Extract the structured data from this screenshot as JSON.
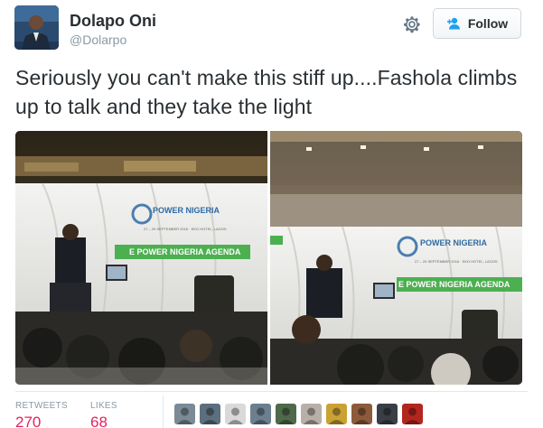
{
  "author": {
    "name": "Dolapo Oni",
    "handle": "@Dolarpo"
  },
  "actions": {
    "gear_icon": "gear-icon",
    "follow_label": "Follow",
    "follow_icon": "add-person-icon"
  },
  "tweet": {
    "text": "Seriously you can't make this stiff up....Fashola climbs up to talk and they take the light"
  },
  "photos": [
    {
      "banner_title": "POWER NIGERIA",
      "banner_date": "27 – 29 SEPTEMBER 2016 · EKO HOTEL, LAGOS",
      "banner_agenda": "E POWER NIGERIA AGENDA"
    },
    {
      "banner_title": "POWER NIGERIA",
      "banner_date": "27 – 29 SEPTEMBER 2016 · EKO HOTEL, LAGOS",
      "banner_agenda": "E POWER NIGERIA AGENDA"
    }
  ],
  "stats": {
    "retweets_label": "RETWEETS",
    "retweets_value": "270",
    "likes_label": "LIKES",
    "likes_value": "68"
  },
  "likers": [
    {
      "color": "#7a8a96"
    },
    {
      "color": "#5b6f7e"
    },
    {
      "color": "#d9d9d9"
    },
    {
      "color": "#6b7f8f"
    },
    {
      "color": "#4e6a4a"
    },
    {
      "color": "#b8b0a8"
    },
    {
      "color": "#c9a233"
    },
    {
      "color": "#8d5a3c"
    },
    {
      "color": "#3a3f47"
    },
    {
      "color": "#b3261e"
    }
  ],
  "colors": {
    "accent": "#1da1f2",
    "stat_value": "#e0245e",
    "muted": "#8899a6",
    "banner_green": "#4caf50"
  }
}
